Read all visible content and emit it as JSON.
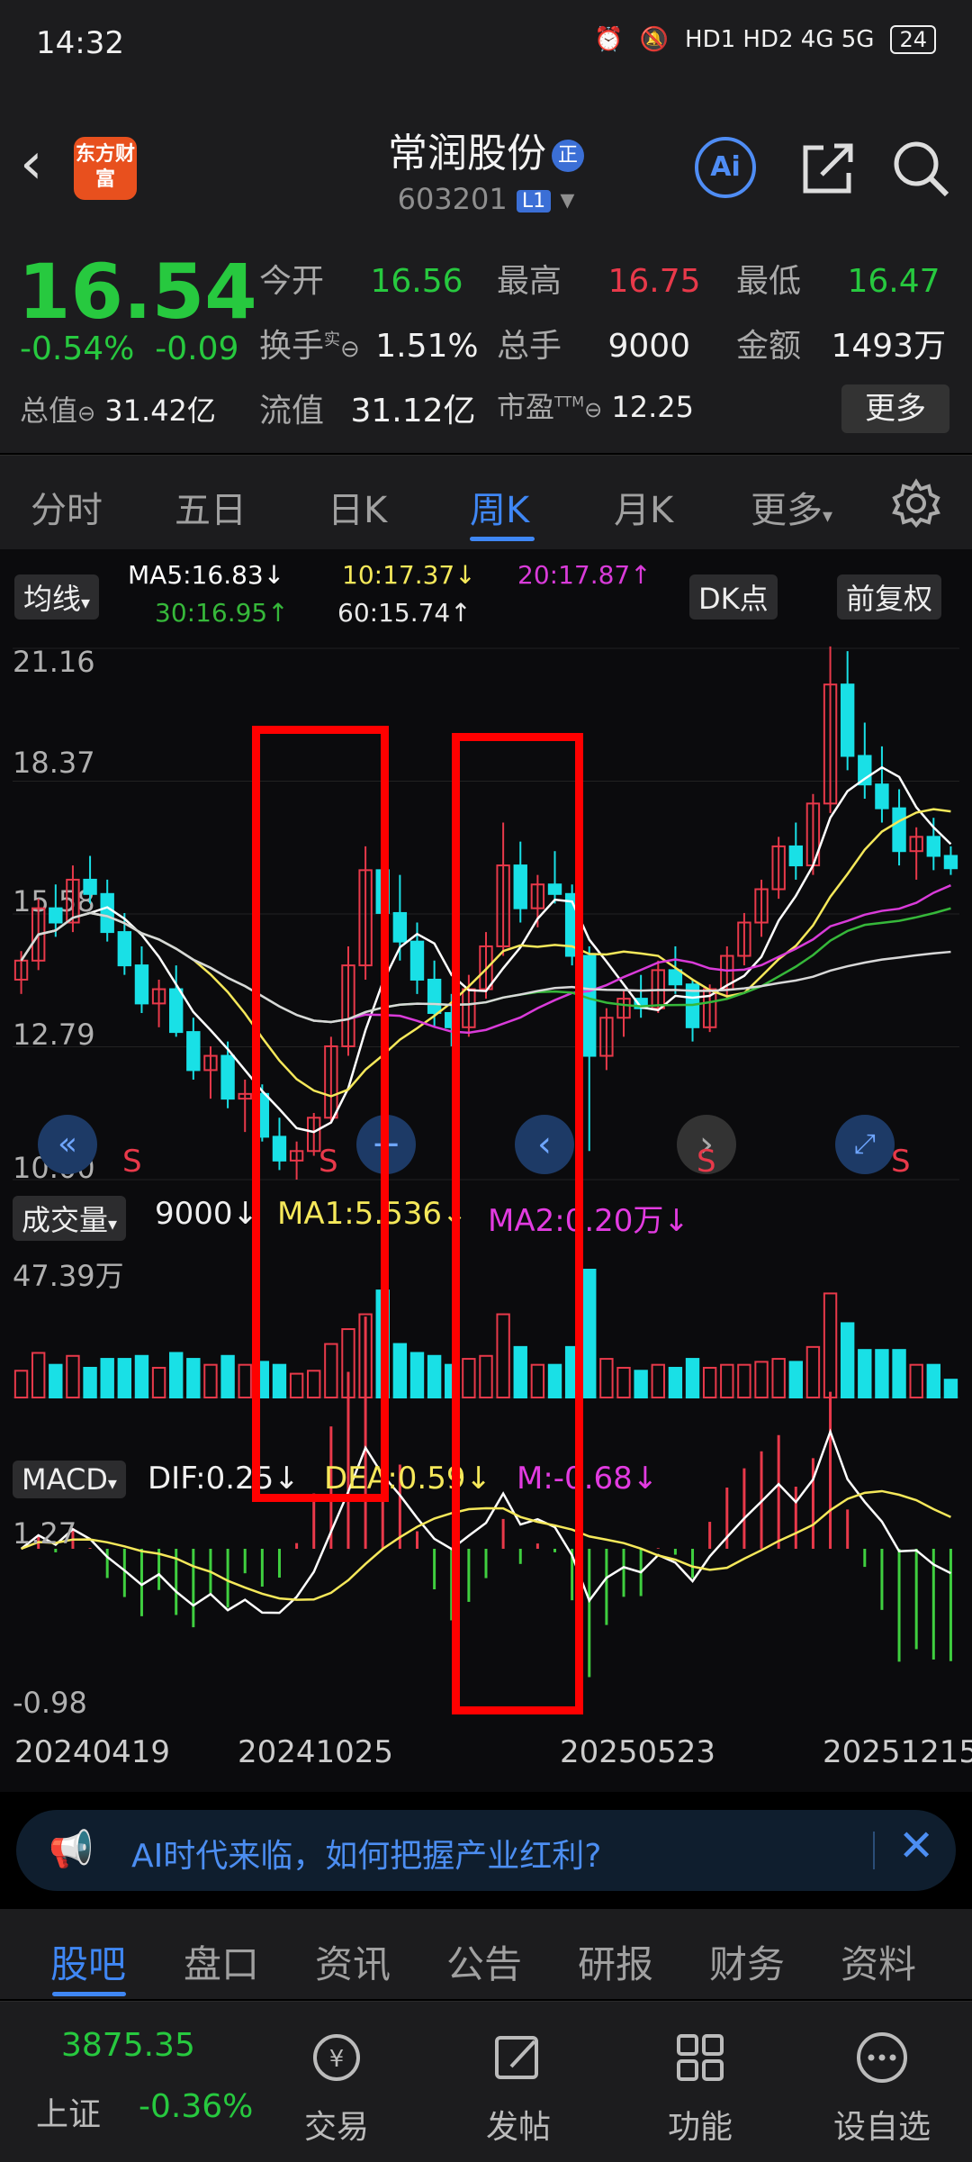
{
  "status_bar": {
    "time": "14:32",
    "network": "HD1 HD2 4G 5G",
    "battery": "24"
  },
  "header": {
    "stock_name": "常润股份",
    "badge": "正",
    "code": "603201",
    "level": "L1",
    "logo_text": "东方财富",
    "ai_label": "Ai"
  },
  "quote": {
    "price": "16.54",
    "change_pct": "-0.54%",
    "change_amt": "-0.09",
    "open_label": "今开",
    "open": "16.56",
    "high_label": "最高",
    "high": "16.75",
    "low_label": "最低",
    "low": "16.47",
    "turnover_label": "换手",
    "turnover_sup": "实",
    "turnover": "1.51%",
    "volume_label": "总手",
    "volume": "9000",
    "amount_label": "金额",
    "amount": "1493万",
    "mktcap_label": "总值",
    "mktcap": "31.42亿",
    "float_label": "流值",
    "float": "31.12亿",
    "pe_label": "市盈",
    "pe_sup": "TTM",
    "pe": "12.25",
    "more_label": "更多"
  },
  "tabs": [
    {
      "label": "分时"
    },
    {
      "label": "五日"
    },
    {
      "label": "日K"
    },
    {
      "label": "周K"
    },
    {
      "label": "月K"
    },
    {
      "label": "更多"
    }
  ],
  "ma_bar": {
    "pill": "均线",
    "ma5": "MA5:16.83↓",
    "ma10": "10:17.37↓",
    "ma20": "20:17.87↑",
    "ma30": "30:16.95↑",
    "ma60": "60:15.74↑",
    "dk": "DK点",
    "fq": "前复权"
  },
  "colors": {
    "up": "#e8394a",
    "down": "#19e0e6",
    "ma5": "#ffffff",
    "ma10": "#f5e85a",
    "ma20": "#d93bd9",
    "ma30": "#36b83a",
    "ma60": "#d8d8d8",
    "accent": "#3f87f5"
  },
  "price_axis": [
    "21.16",
    "18.37",
    "15.58",
    "12.79",
    "10.00"
  ],
  "volume_bar": {
    "pill": "成交量",
    "vol": "9000↓",
    "ma1": "MA1:5.536↓",
    "ma2": "MA2:0.20万↓",
    "top": "47.39万"
  },
  "macd_bar": {
    "pill": "MACD",
    "dif": "DIF:0.25↓",
    "dea": "DEA:0.59↓",
    "m": "M:-0.68↓",
    "top": "1.27",
    "bottom": "-0.98"
  },
  "dates": [
    "20240419",
    "20241025",
    "20250523",
    "20251215"
  ],
  "signals": [
    "S",
    "S",
    "S",
    "S"
  ],
  "banner": {
    "text": "AI时代来临，如何把握产业红利?"
  },
  "subtabs": [
    {
      "label": "股吧"
    },
    {
      "label": "盘口"
    },
    {
      "label": "资讯"
    },
    {
      "label": "公告"
    },
    {
      "label": "研报"
    },
    {
      "label": "财务"
    },
    {
      "label": "资料"
    }
  ],
  "bottom_nav": {
    "index_value": "3875.35",
    "index_name": "上证",
    "index_change": "-0.36%",
    "items": [
      {
        "label": "交易"
      },
      {
        "label": "发帖"
      },
      {
        "label": "功能"
      },
      {
        "label": "设自选"
      }
    ]
  },
  "chart_data": {
    "type": "candlestick",
    "period": "weekly",
    "x_range": [
      "20240419",
      "20251215"
    ],
    "y_range": [
      10.0,
      21.16
    ],
    "ohlc": [
      [
        14.2,
        14.8,
        13.9,
        14.6
      ],
      [
        14.6,
        15.9,
        14.4,
        15.7
      ],
      [
        15.7,
        16.2,
        15.1,
        15.4
      ],
      [
        15.4,
        16.6,
        15.2,
        16.3
      ],
      [
        16.3,
        16.8,
        15.8,
        16.0
      ],
      [
        16.0,
        16.3,
        15.0,
        15.2
      ],
      [
        15.2,
        15.6,
        14.3,
        14.5
      ],
      [
        14.5,
        14.9,
        13.5,
        13.7
      ],
      [
        13.7,
        14.2,
        13.2,
        14.0
      ],
      [
        14.0,
        14.5,
        13.0,
        13.1
      ],
      [
        13.1,
        13.4,
        12.1,
        12.3
      ],
      [
        12.3,
        12.8,
        11.7,
        12.6
      ],
      [
        12.6,
        12.9,
        11.5,
        11.7
      ],
      [
        11.7,
        12.1,
        11.0,
        11.8
      ],
      [
        11.8,
        12.0,
        10.8,
        10.9
      ],
      [
        10.9,
        11.3,
        10.2,
        10.4
      ],
      [
        10.4,
        10.8,
        10.0,
        10.6
      ],
      [
        10.6,
        11.4,
        10.5,
        11.3
      ],
      [
        11.3,
        13.0,
        11.2,
        12.8
      ],
      [
        12.8,
        14.9,
        12.6,
        14.5
      ],
      [
        14.5,
        17.0,
        14.2,
        16.5
      ],
      [
        16.5,
        18.9,
        15.3,
        15.6
      ],
      [
        15.6,
        16.4,
        14.6,
        15.0
      ],
      [
        15.0,
        15.4,
        13.9,
        14.2
      ],
      [
        14.2,
        14.6,
        13.2,
        13.5
      ],
      [
        13.5,
        13.9,
        12.8,
        13.2
      ],
      [
        13.2,
        14.3,
        13.0,
        14.0
      ],
      [
        14.0,
        15.2,
        13.8,
        14.9
      ],
      [
        14.9,
        17.5,
        14.7,
        16.6
      ],
      [
        16.6,
        17.1,
        15.4,
        15.7
      ],
      [
        15.7,
        16.4,
        15.3,
        16.2
      ],
      [
        16.2,
        16.9,
        15.8,
        16.0
      ],
      [
        16.0,
        16.2,
        14.5,
        14.7
      ],
      [
        14.7,
        14.9,
        10.6,
        12.6
      ],
      [
        12.6,
        13.6,
        12.3,
        13.4
      ],
      [
        13.4,
        14.0,
        13.0,
        13.8
      ],
      [
        13.8,
        14.3,
        13.4,
        13.6
      ],
      [
        13.6,
        14.6,
        13.5,
        14.4
      ],
      [
        14.4,
        14.9,
        13.9,
        14.1
      ],
      [
        14.1,
        14.2,
        12.9,
        13.2
      ],
      [
        13.2,
        14.1,
        13.1,
        14.0
      ],
      [
        14.0,
        14.9,
        13.8,
        14.7
      ],
      [
        14.7,
        15.6,
        14.5,
        15.4
      ],
      [
        15.4,
        16.3,
        15.1,
        16.1
      ],
      [
        16.1,
        17.2,
        15.9,
        17.0
      ],
      [
        17.0,
        17.5,
        16.3,
        16.6
      ],
      [
        16.6,
        18.1,
        16.4,
        17.9
      ],
      [
        17.9,
        21.2,
        17.7,
        20.4
      ],
      [
        20.4,
        21.1,
        18.6,
        18.9
      ],
      [
        18.9,
        19.6,
        18.0,
        18.3
      ],
      [
        18.3,
        19.1,
        17.5,
        17.8
      ],
      [
        17.8,
        18.2,
        16.6,
        16.9
      ],
      [
        16.9,
        17.4,
        16.3,
        17.2
      ],
      [
        17.2,
        17.6,
        16.5,
        16.8
      ],
      [
        16.8,
        17.0,
        16.4,
        16.54
      ]
    ],
    "volume_top": "47.39万",
    "macd_range": [
      -0.98,
      1.27
    ],
    "ma_values": {
      "MA5": 16.83,
      "MA10": 17.37,
      "MA20": 17.87,
      "MA30": 16.95,
      "MA60": 15.74
    }
  }
}
